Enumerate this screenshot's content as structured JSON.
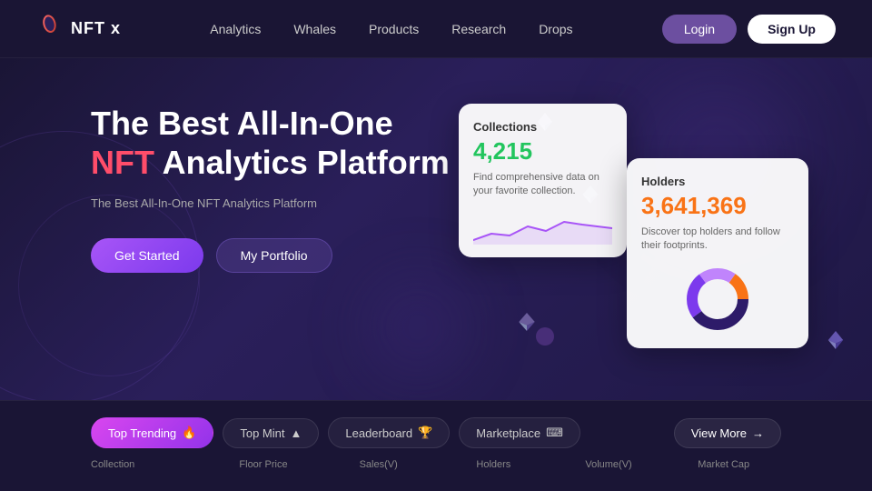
{
  "brand": {
    "name": "NFT x"
  },
  "nav": {
    "links": [
      "Analytics",
      "Whales",
      "Products",
      "Research",
      "Drops"
    ],
    "login_label": "Login",
    "signup_label": "Sign Up"
  },
  "hero": {
    "title_line1": "The Best All-In-One",
    "title_line2_prefix": "NFT",
    "title_line2_suffix": " Analytics Platform",
    "subtitle": "The Best All-In-One NFT Analytics Platform",
    "btn_get_started": "Get Started",
    "btn_portfolio": "My Portfolio"
  },
  "card_collections": {
    "title": "Collections",
    "value": "4,215",
    "description": "Find comprehensive data on your favorite collection."
  },
  "card_holders": {
    "title": "Holders",
    "value": "3,641,369",
    "description": "Discover top holders and follow their footprints."
  },
  "tabs": [
    {
      "label": "Top Trending",
      "icon": "🔥",
      "active": true
    },
    {
      "label": "Top Mint",
      "icon": "▲",
      "active": false
    },
    {
      "label": "Leaderboard",
      "icon": "🏆",
      "active": false
    },
    {
      "label": "Marketplace",
      "icon": "⌨",
      "active": false
    }
  ],
  "view_more_label": "View More",
  "table_headers": [
    "Collection",
    "Floor Price",
    "Sales(V)",
    "Holders",
    "Volume(V)",
    "Market Cap"
  ]
}
